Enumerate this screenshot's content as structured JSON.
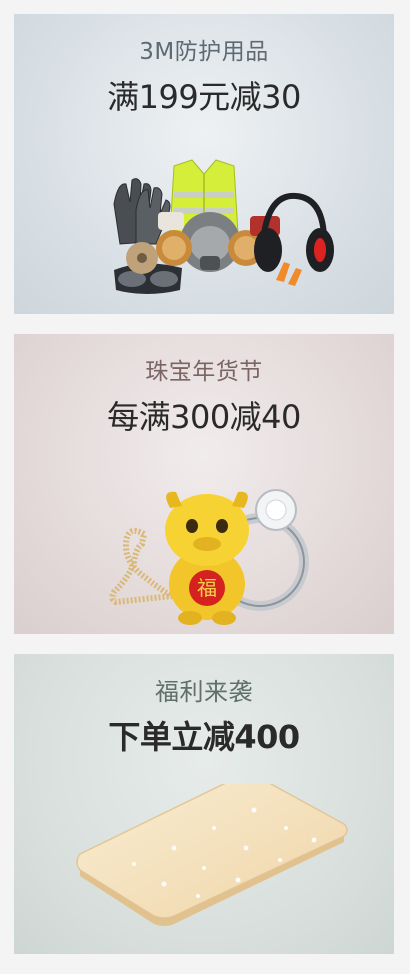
{
  "cards": [
    {
      "id": "protection",
      "subtitle": "3M防护用品",
      "title": "满199元减30",
      "image_icon": "safety-gear-image"
    },
    {
      "id": "jewelry",
      "subtitle": "珠宝年货节",
      "title": "每满300减40",
      "image_icon": "gold-ox-jewelry-image",
      "image_text": "福"
    },
    {
      "id": "lighting",
      "subtitle": "福利来袭",
      "title": "下单立减400",
      "image_icon": "ceiling-light-image"
    }
  ]
}
